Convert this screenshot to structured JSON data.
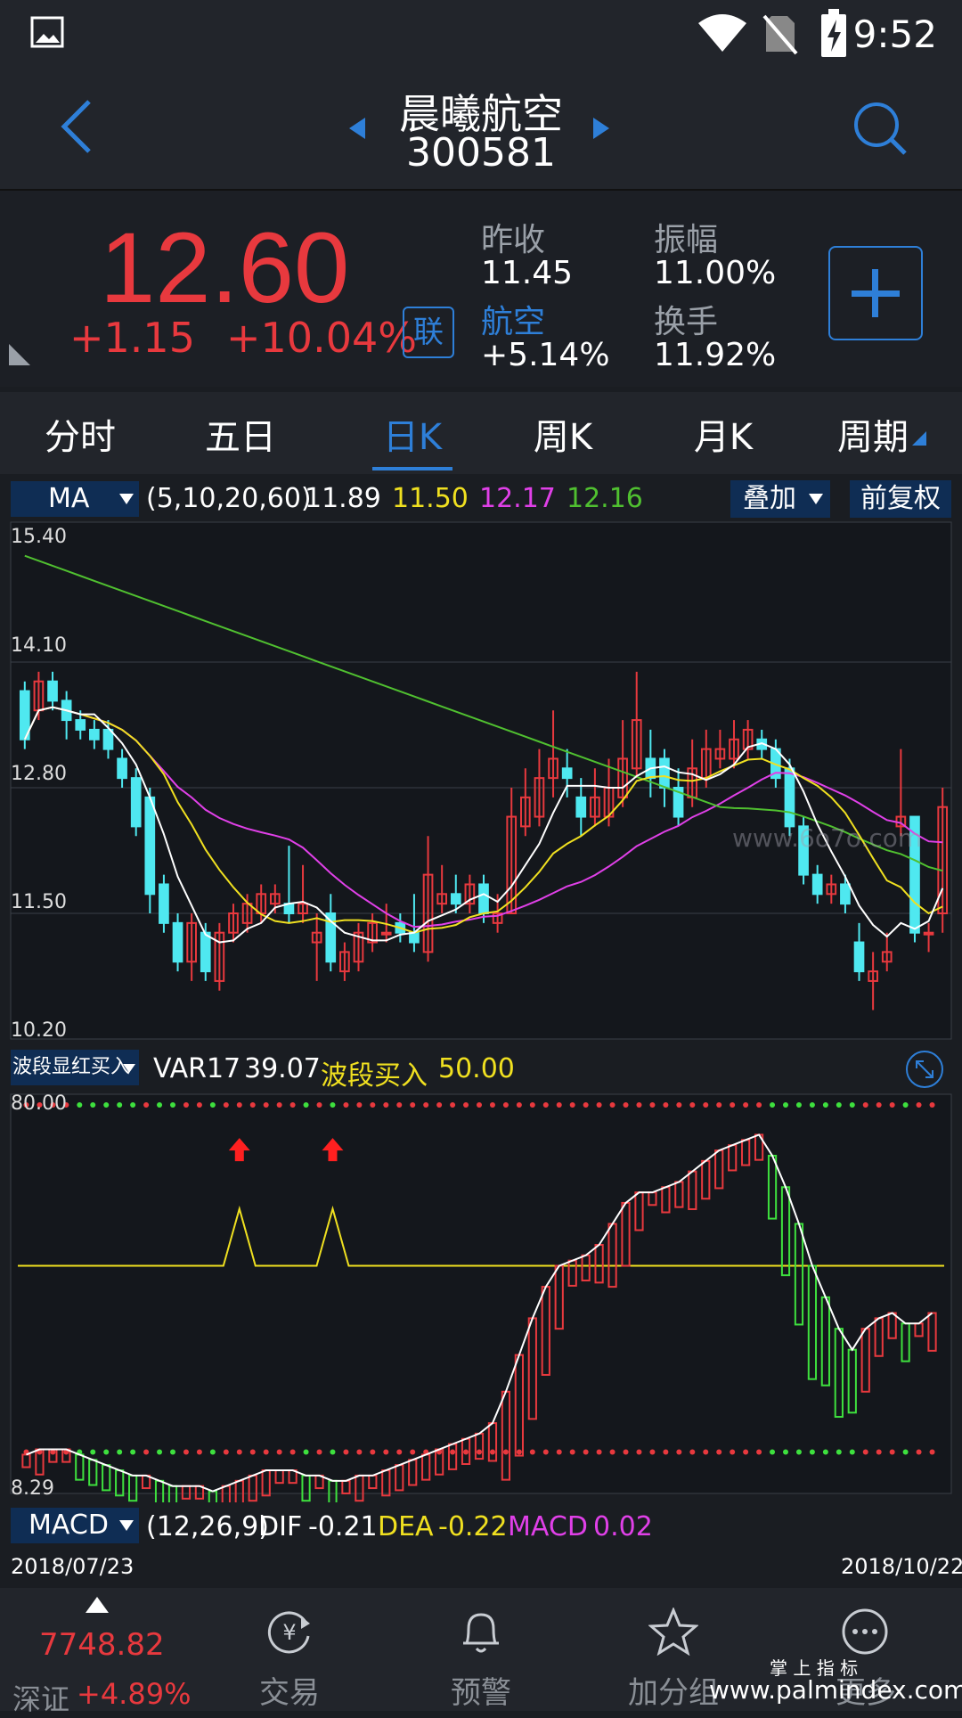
{
  "status_bar": {
    "time": "9:52"
  },
  "header": {
    "title": "晨曦航空",
    "code": "300581"
  },
  "quote": {
    "price": "12.60",
    "change": "+1.15",
    "change_pct": "+10.04%",
    "link_badge": "联",
    "prev_close_label": "昨收",
    "prev_close": "11.45",
    "amplitude_label": "振幅",
    "amplitude": "11.00%",
    "sector_label": "航空",
    "sector_change": "+5.14%",
    "turnover_label": "换手",
    "turnover": "11.92%"
  },
  "tabs": [
    "分时",
    "五日",
    "日K",
    "周K",
    "月K",
    "周期"
  ],
  "active_tab": "日K",
  "ma_bar": {
    "selector": "MA",
    "params": "(5,10,20,60)",
    "ma5": "11.89",
    "ma10": "11.50",
    "ma20": "12.17",
    "ma60": "12.16",
    "overlay_button": "叠加",
    "adjust_button": "前复权"
  },
  "indicator_bar": {
    "selector": "波段显红买入",
    "var_label": "VAR17",
    "var_value": "39.07",
    "buy_label": "波段买入",
    "buy_value": "50.00"
  },
  "macd_bar": {
    "selector": "MACD",
    "params": "(12,26,9)",
    "dif_label": "DIF",
    "dif_value": "-0.21",
    "dea_label": "DEA",
    "dea_value": "-0.22",
    "macd_label": "MACD",
    "macd_value": "0.02"
  },
  "dates": {
    "start": "2018/07/23",
    "end": "2018/10/22"
  },
  "bottom_nav": {
    "index_value": "7748.82",
    "index_name": "深证",
    "index_change": "+4.89%",
    "items": [
      "交易",
      "预警",
      "加分组",
      "更多"
    ]
  },
  "watermarks": {
    "chart": "www.6o7o.com",
    "site_cn": "掌 上 指 标",
    "site_url": "www.palmindex.com"
  },
  "colors": {
    "up": "#e8393e",
    "down": "#4fe8f0",
    "accent": "#2e7fd8",
    "ma5": "#ffffff",
    "ma10": "#f0e020",
    "ma20": "#e040e8",
    "ma60": "#50c030"
  },
  "chart_data": [
    {
      "type": "candlestick",
      "ylim": [
        10.2,
        15.4
      ],
      "y_ticks": [
        "15.40",
        "14.10",
        "12.80",
        "11.50",
        "10.20"
      ],
      "x": [
        "2018/07/23",
        "2018/10/22"
      ],
      "candles": [
        [
          13.8,
          13.3,
          13.9,
          13.2
        ],
        [
          13.6,
          13.9,
          14.0,
          13.5
        ],
        [
          13.9,
          13.7,
          14.0,
          13.6
        ],
        [
          13.7,
          13.5,
          13.8,
          13.3
        ],
        [
          13.5,
          13.4,
          13.6,
          13.3
        ],
        [
          13.4,
          13.3,
          13.5,
          13.2
        ],
        [
          13.4,
          13.2,
          13.5,
          13.1
        ],
        [
          13.1,
          12.9,
          13.2,
          12.8
        ],
        [
          12.9,
          12.4,
          13.0,
          12.3
        ],
        [
          12.7,
          11.7,
          12.8,
          11.5
        ],
        [
          11.8,
          11.4,
          11.9,
          11.3
        ],
        [
          11.4,
          11.0,
          11.5,
          10.9
        ],
        [
          11.0,
          11.4,
          11.5,
          10.8
        ],
        [
          11.3,
          10.9,
          11.4,
          10.8
        ],
        [
          10.8,
          11.3,
          11.4,
          10.7
        ],
        [
          11.3,
          11.5,
          11.6,
          11.2
        ],
        [
          11.4,
          11.6,
          11.7,
          11.3
        ],
        [
          11.5,
          11.7,
          11.8,
          11.4
        ],
        [
          11.6,
          11.7,
          11.8,
          11.5
        ],
        [
          11.6,
          11.5,
          12.2,
          11.4
        ],
        [
          11.5,
          11.6,
          12.0,
          11.4
        ],
        [
          11.2,
          11.3,
          11.5,
          10.8
        ],
        [
          11.5,
          11.0,
          11.7,
          10.9
        ],
        [
          10.9,
          11.1,
          11.2,
          10.8
        ],
        [
          11.0,
          11.3,
          11.4,
          10.9
        ],
        [
          11.2,
          11.4,
          11.5,
          11.1
        ],
        [
          11.3,
          11.3,
          11.6,
          11.2
        ],
        [
          11.4,
          11.3,
          11.5,
          11.2
        ],
        [
          11.3,
          11.2,
          11.7,
          11.1
        ],
        [
          11.1,
          11.9,
          12.3,
          11.0
        ],
        [
          11.6,
          11.7,
          12.0,
          11.5
        ],
        [
          11.7,
          11.6,
          11.9,
          11.5
        ],
        [
          11.6,
          11.8,
          11.9,
          11.5
        ],
        [
          11.8,
          11.5,
          11.9,
          11.4
        ],
        [
          11.4,
          11.5,
          11.7,
          11.3
        ],
        [
          11.5,
          12.5,
          12.8,
          11.5
        ],
        [
          12.4,
          12.7,
          13.0,
          12.3
        ],
        [
          12.5,
          12.9,
          13.2,
          12.4
        ],
        [
          12.9,
          13.1,
          13.6,
          12.7
        ],
        [
          13.0,
          12.9,
          13.2,
          12.7
        ],
        [
          12.7,
          12.5,
          12.9,
          12.3
        ],
        [
          12.5,
          12.7,
          13.0,
          12.4
        ],
        [
          12.5,
          12.8,
          13.1,
          12.4
        ],
        [
          12.7,
          13.1,
          13.5,
          12.6
        ],
        [
          13.0,
          13.5,
          14.0,
          12.9
        ],
        [
          13.1,
          12.9,
          13.4,
          12.7
        ],
        [
          13.1,
          12.8,
          13.2,
          12.6
        ],
        [
          12.8,
          12.5,
          13.0,
          12.4
        ],
        [
          12.7,
          13.0,
          13.3,
          12.6
        ],
        [
          12.9,
          13.2,
          13.4,
          12.8
        ],
        [
          13.1,
          13.2,
          13.4,
          13.0
        ],
        [
          13.1,
          13.3,
          13.5,
          13.0
        ],
        [
          13.2,
          13.4,
          13.5,
          13.1
        ],
        [
          13.3,
          13.2,
          13.4,
          13.1
        ],
        [
          13.2,
          12.9,
          13.3,
          12.8
        ],
        [
          13.0,
          12.4,
          13.1,
          12.3
        ],
        [
          12.4,
          11.9,
          12.5,
          11.8
        ],
        [
          11.9,
          11.7,
          12.0,
          11.6
        ],
        [
          11.7,
          11.8,
          11.9,
          11.6
        ],
        [
          11.8,
          11.6,
          11.9,
          11.5
        ],
        [
          11.2,
          10.9,
          11.4,
          10.8
        ],
        [
          10.8,
          10.9,
          11.1,
          10.5
        ],
        [
          11.0,
          11.1,
          11.3,
          10.9
        ],
        [
          12.4,
          12.5,
          13.2,
          12.3
        ],
        [
          12.5,
          11.3,
          12.5,
          11.2
        ],
        [
          11.3,
          11.3,
          11.4,
          11.1
        ],
        [
          11.5,
          12.6,
          12.8,
          11.3
        ]
      ],
      "ma_values": {
        "ma5": "11.89",
        "ma10": "11.50",
        "ma20": "12.17",
        "ma60": "12.16"
      }
    },
    {
      "type": "oscillator",
      "ylim": [
        8.29,
        80.0
      ],
      "y_ticks": [
        "80.00",
        "8.29"
      ],
      "line_y": 50.0,
      "var17": [
        14,
        15,
        15,
        15,
        14,
        13,
        12,
        11,
        10,
        10,
        9,
        8,
        8,
        8,
        7,
        8,
        9,
        10,
        11,
        11,
        11,
        10,
        10,
        9,
        9,
        10,
        10,
        11,
        12,
        13,
        14,
        15,
        16,
        17,
        18,
        20,
        26,
        33,
        40,
        46,
        50,
        51,
        52,
        54,
        58,
        62,
        64,
        64,
        65,
        66,
        68,
        70,
        72,
        73,
        74,
        75,
        71,
        65,
        58,
        50,
        44,
        38,
        34,
        38,
        40,
        41,
        39,
        39,
        41
      ],
      "signals": [
        16,
        23
      ]
    }
  ]
}
